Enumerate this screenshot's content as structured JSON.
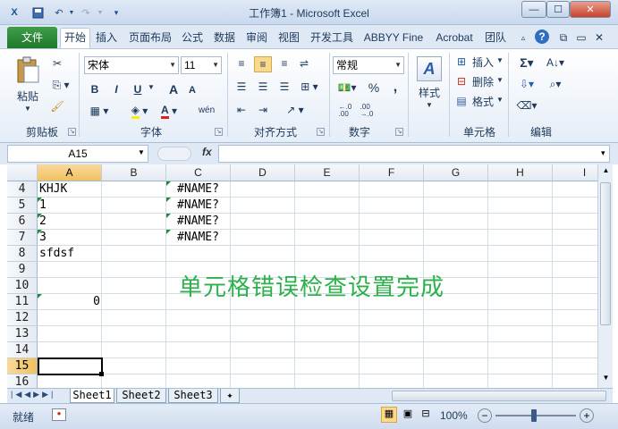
{
  "title": "工作簿1 - Microsoft Excel",
  "quick_access": {
    "save_icon": "save-icon",
    "undo_icon": "undo-icon",
    "redo_icon": "redo-icon"
  },
  "window_controls": {
    "minimize": "—",
    "maximize": "☐",
    "close": "✕"
  },
  "file_tab": "文件",
  "tabs": [
    "开始",
    "插入",
    "页面布局",
    "公式",
    "数据",
    "审阅",
    "视图",
    "开发工具",
    "ABBYY Fine",
    "Acrobat",
    "团队"
  ],
  "ribbon": {
    "clipboard": {
      "paste": "粘贴",
      "group": "剪贴板"
    },
    "font": {
      "name": "宋体",
      "size": "11",
      "group": "字体",
      "bold": "B",
      "italic": "I",
      "underline": "U",
      "grow": "A",
      "shrink": "A",
      "phonetic": "wén"
    },
    "alignment": {
      "group": "对齐方式"
    },
    "number": {
      "format": "常规",
      "percent": "%",
      "comma": ",",
      "group": "数字"
    },
    "styles": {
      "label": "样式"
    },
    "cells": {
      "insert": "插入",
      "delete": "删除",
      "format": "格式",
      "group": "单元格"
    },
    "editing": {
      "group": "编辑"
    }
  },
  "formula_bar": {
    "name_box": "A15",
    "fx": "fx",
    "value": ""
  },
  "columns": [
    "A",
    "B",
    "C",
    "D",
    "E",
    "F",
    "G",
    "H",
    "I"
  ],
  "rows": [
    "4",
    "5",
    "6",
    "7",
    "8",
    "9",
    "10",
    "11",
    "12",
    "13",
    "14",
    "15",
    "16"
  ],
  "cells": {
    "A4": "KHJK",
    "A5": "1",
    "A6": "2",
    "A7": "3",
    "A8": "sfdsf",
    "B11": "0",
    "C4": "#NAME?",
    "C5": "#NAME?",
    "C6": "#NAME?",
    "C7": "#NAME?"
  },
  "overlay_text": "单元格错误检查设置完成",
  "sheets": [
    "Sheet1",
    "Sheet2",
    "Sheet3"
  ],
  "status": {
    "ready": "就绪",
    "zoom": "100%"
  },
  "selected_cell": "A15",
  "colors": {
    "file_tab": "#2a8a36",
    "overlay": "#2db14b",
    "selection": "#f1c15f",
    "error_marker": "#1f8a3a"
  }
}
